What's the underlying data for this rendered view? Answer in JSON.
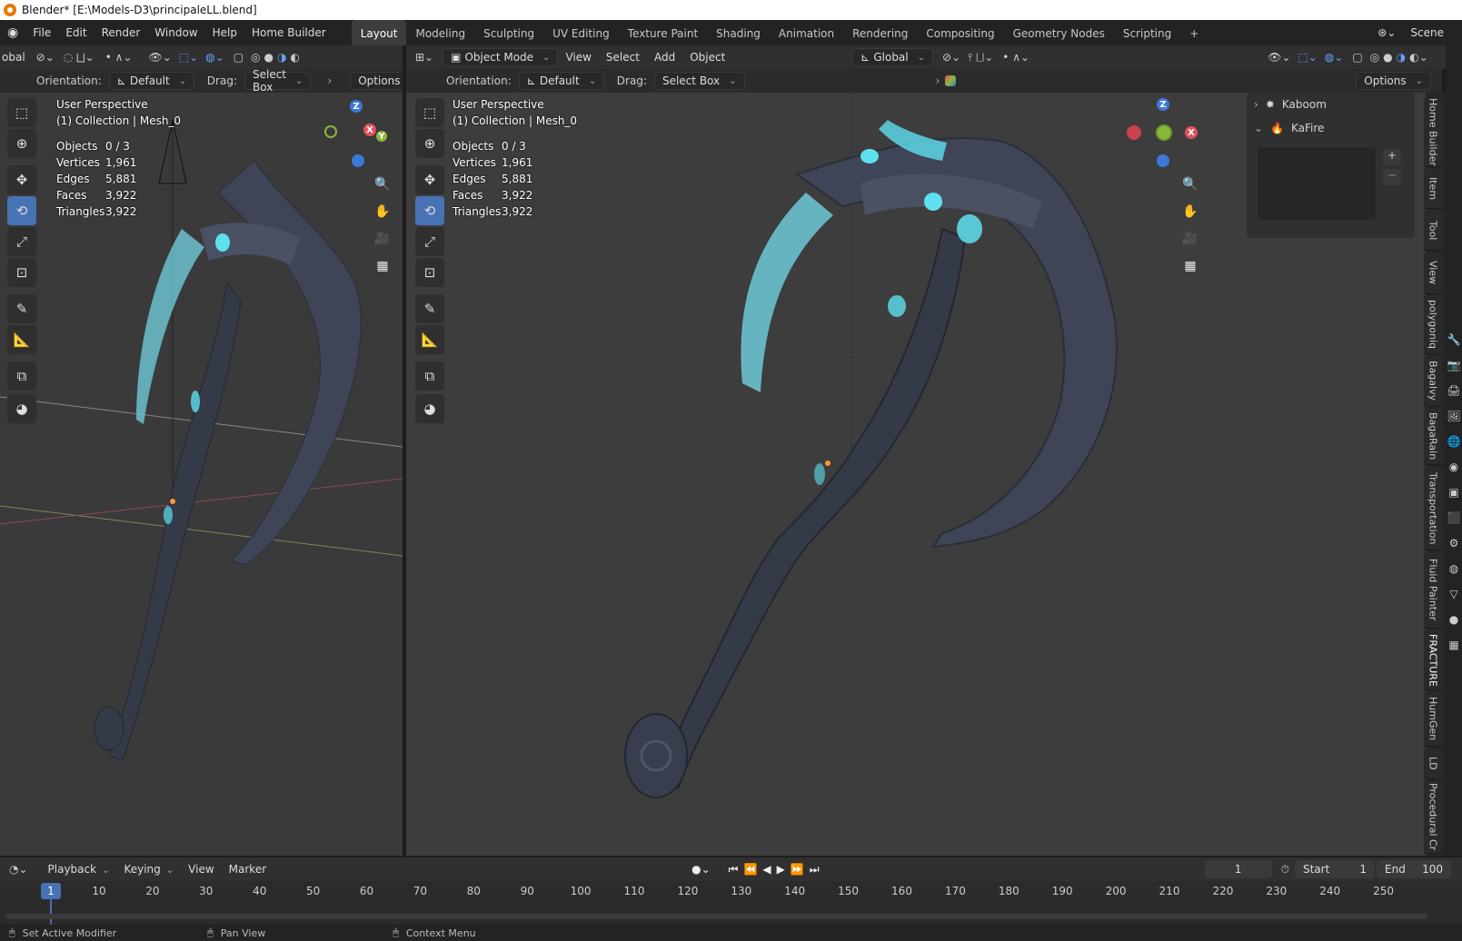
{
  "window_title": "Blender* [E:\\Models-D3\\principaleLL.blend]",
  "menu": [
    "File",
    "Edit",
    "Render",
    "Window",
    "Help",
    "Home Builder"
  ],
  "workspaces": [
    "Layout",
    "Modeling",
    "Sculpting",
    "UV Editing",
    "Texture Paint",
    "Shading",
    "Animation",
    "Rendering",
    "Compositing",
    "Geometry Nodes",
    "Scripting"
  ],
  "active_workspace": "Layout",
  "scene_label": "Scene",
  "left_view": {
    "transform_label": "obal",
    "orientation_label": "Orientation:",
    "orientation_value": "Default",
    "drag_label": "Drag:",
    "drag_value": "Select Box",
    "options": "Options",
    "perspective": "User Perspective",
    "collection": "(1) Collection | Mesh_0"
  },
  "right_view": {
    "mode": "Object Mode",
    "menus": [
      "View",
      "Select",
      "Add",
      "Object"
    ],
    "transform": "Global",
    "orientation_label": "Orientation:",
    "orientation_value": "Default",
    "drag_label": "Drag:",
    "drag_value": "Select Box",
    "options": "Options",
    "perspective": "User Perspective",
    "collection": "(1) Collection | Mesh_0"
  },
  "stats": [
    {
      "k": "Objects",
      "v": "0 / 3"
    },
    {
      "k": "Vertices",
      "v": "1,961"
    },
    {
      "k": "Edges",
      "v": "5,881"
    },
    {
      "k": "Faces",
      "v": "3,922"
    },
    {
      "k": "Triangles",
      "v": "3,922"
    }
  ],
  "panel": {
    "items": [
      "Kaboom",
      "KaFire"
    ]
  },
  "side_tabs": [
    "Home Builder",
    "Item",
    "Tool",
    "View",
    "polygoniq",
    "Bagalvy",
    "BagaRain",
    "Transportation",
    "Fluid Painter",
    "FRACTURE",
    "HumGen",
    "LD",
    "Procedural Cr"
  ],
  "timeline": {
    "menus": [
      "Playback",
      "Keying",
      "View",
      "Marker"
    ],
    "current_frame": "1",
    "start_label": "Start",
    "start": "1",
    "end_label": "End",
    "end": "100",
    "ticks": [
      "1",
      "10",
      "20",
      "30",
      "40",
      "50",
      "60",
      "70",
      "80",
      "90",
      "100",
      "110",
      "120",
      "130",
      "140",
      "150",
      "160",
      "170",
      "180",
      "190",
      "200",
      "210",
      "220",
      "230",
      "240",
      "250"
    ]
  },
  "status": [
    "Set Active Modifier",
    "Pan View",
    "Context Menu"
  ],
  "colors": {
    "accent": "#4772b3",
    "x_axis": "#e44f5c",
    "y_axis": "#8bb83b",
    "z_axis": "#3c78d8",
    "glow": "#5ee0ef"
  }
}
